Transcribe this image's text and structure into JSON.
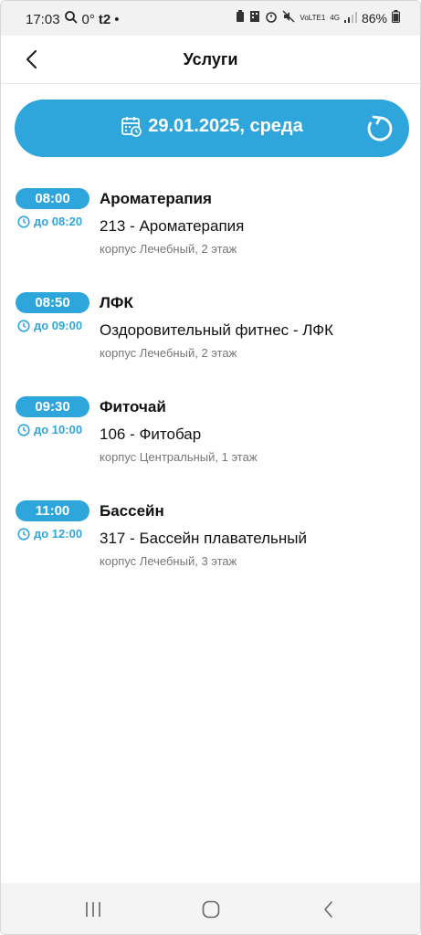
{
  "status_bar": {
    "time": "17:03",
    "temperature": "0°",
    "carrier": "t2",
    "dot": "•",
    "vo_lte": "VoLTE1",
    "network": "4G",
    "battery": "86%"
  },
  "header": {
    "title": "Услуги",
    "back_icon": "chevron-left-icon"
  },
  "date_selector": {
    "date_label": "29.01.2025, среда",
    "calendar_icon": "calendar-icon",
    "refresh_icon": "refresh-icon"
  },
  "services": [
    {
      "start": "08:00",
      "end": "до 08:20",
      "name": "Ароматерапия",
      "room": "213 - Ароматерапия",
      "location": "корпус Лечебный, 2 этаж"
    },
    {
      "start": "08:50",
      "end": "до 09:00",
      "name": "ЛФК",
      "room": "Оздоровительный фитнес - ЛФК",
      "location": "корпус Лечебный, 2 этаж"
    },
    {
      "start": "09:30",
      "end": "до 10:00",
      "name": "Фиточай",
      "room": "106 - Фитобар",
      "location": "корпус Центральный, 1 этаж"
    },
    {
      "start": "11:00",
      "end": "до 12:00",
      "name": "Бассейн",
      "room": "317 - Бассейн плавательный",
      "location": "корпус Лечебный, 3 этаж"
    }
  ],
  "colors": {
    "accent": "#2ea6dc",
    "text_primary": "#111111",
    "text_secondary": "#777777"
  }
}
